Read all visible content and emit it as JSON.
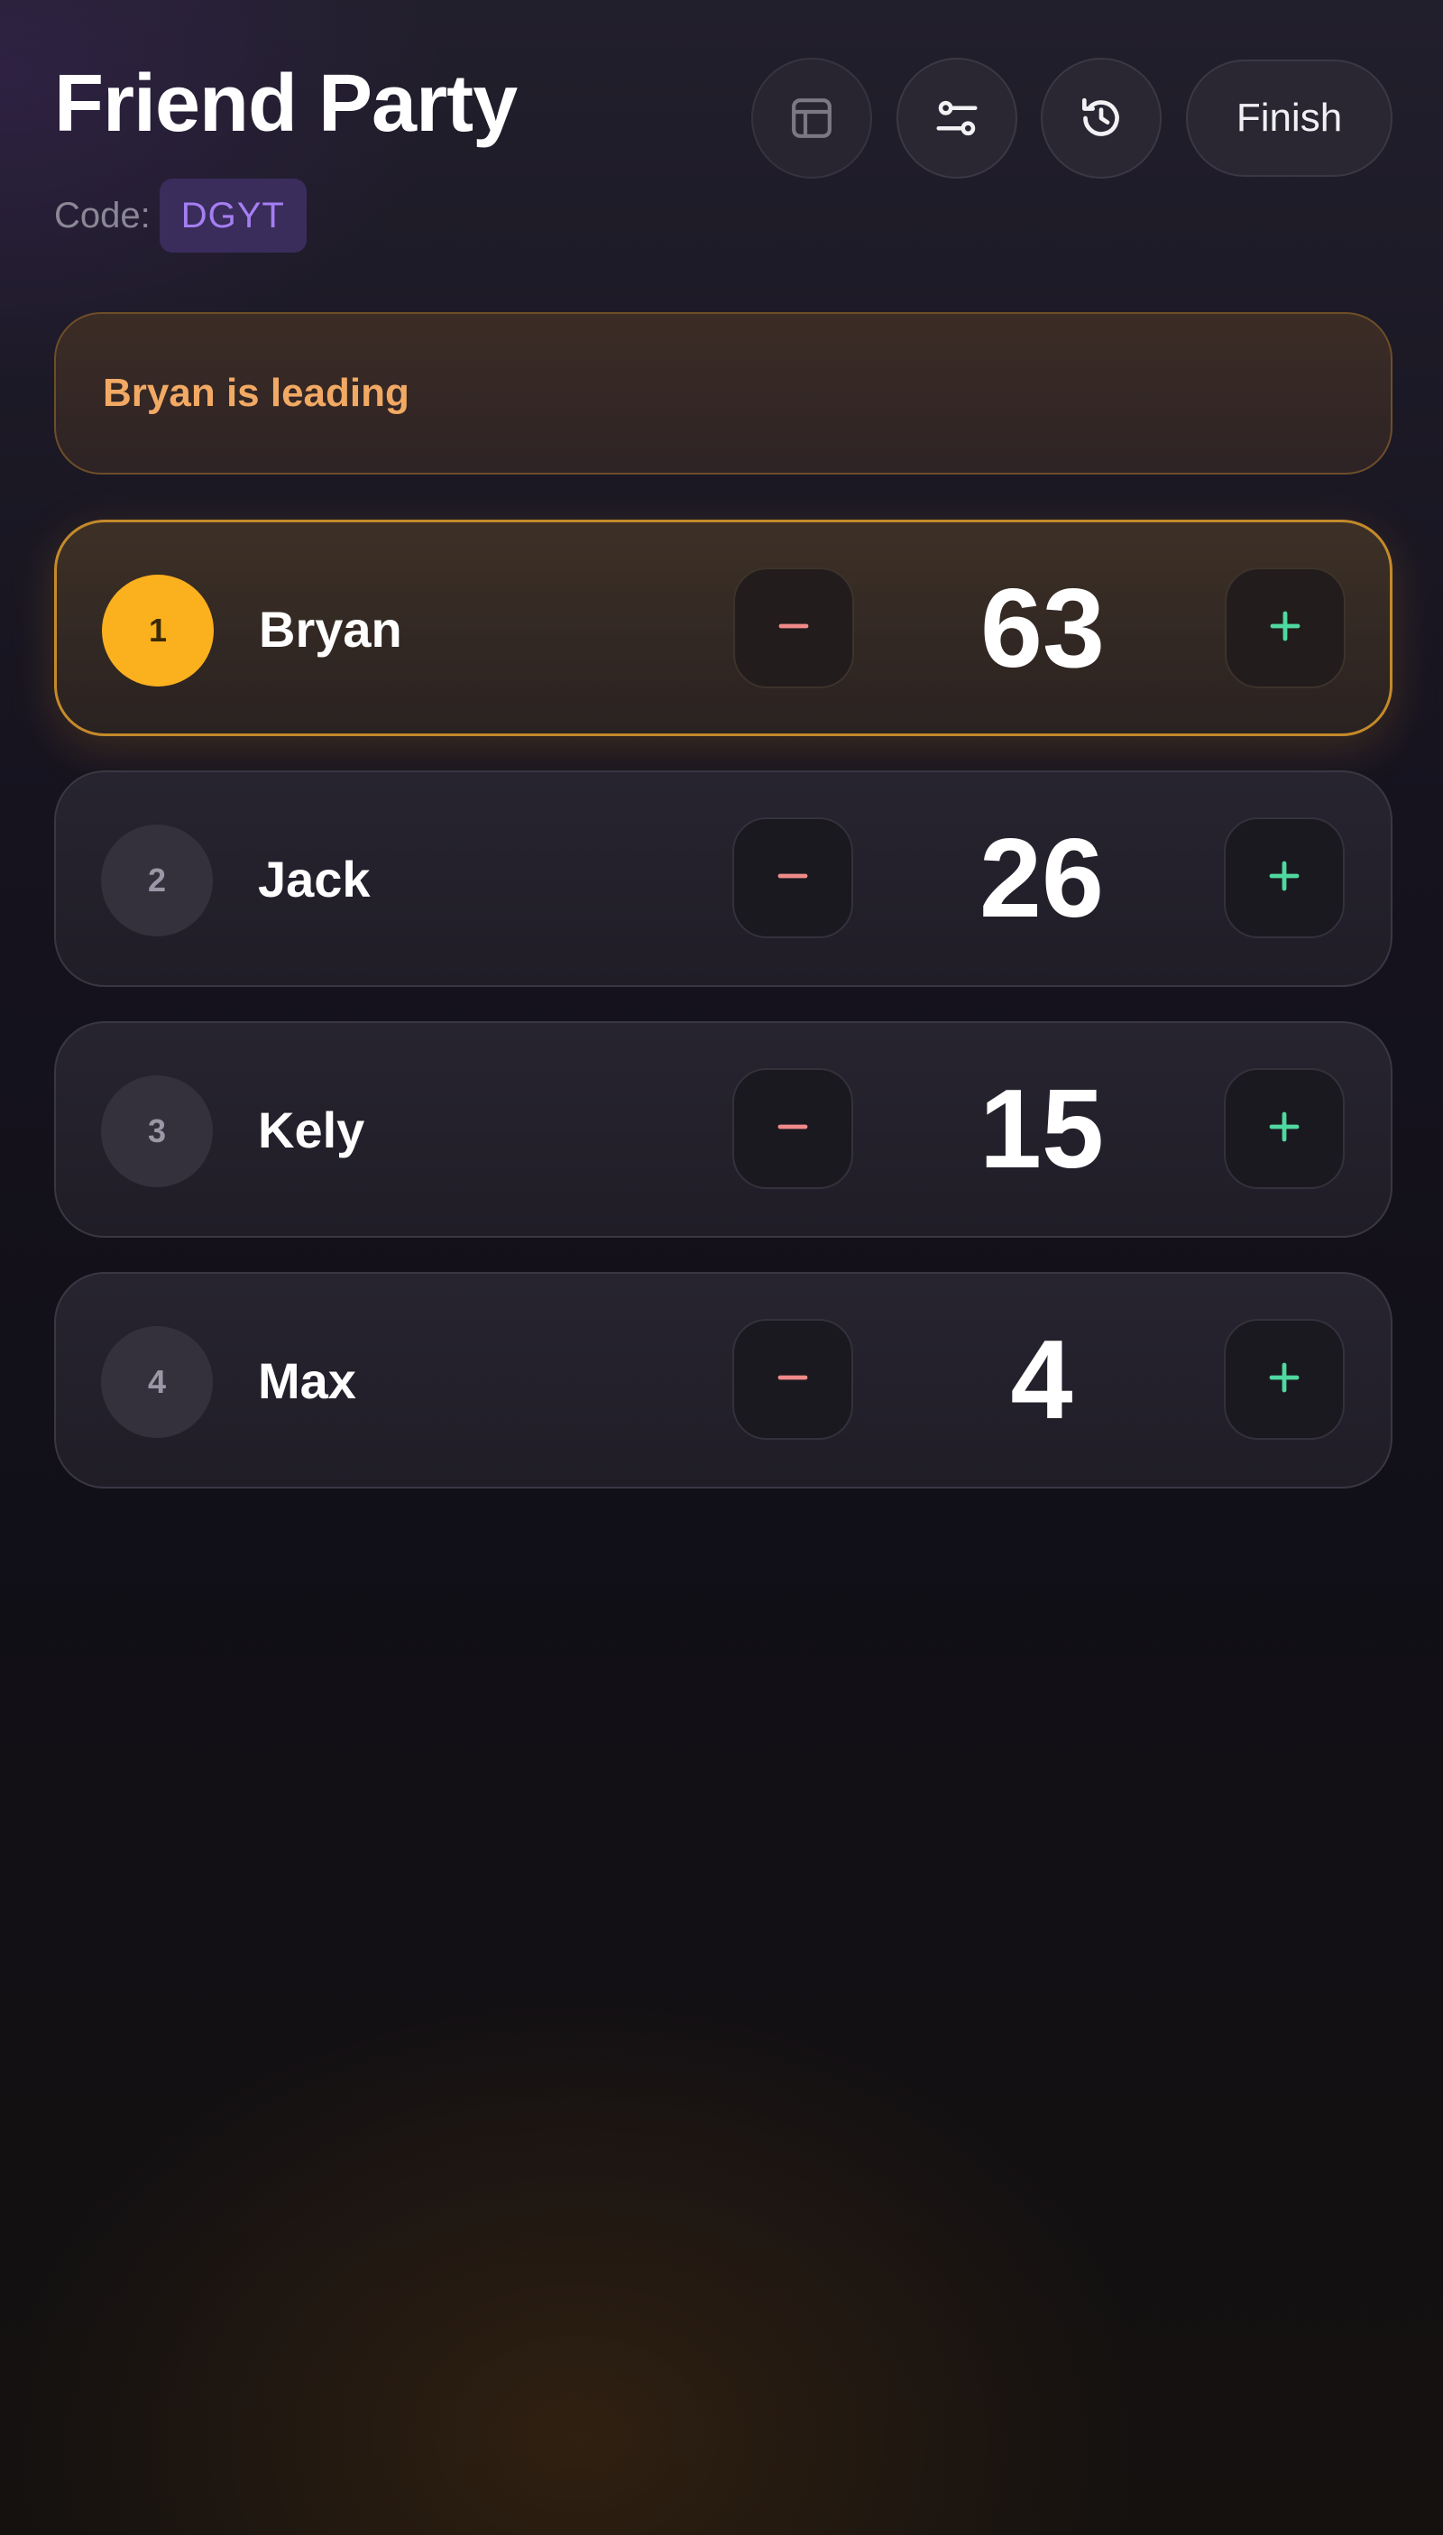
{
  "header": {
    "title": "Friend Party",
    "code_label": "Code:",
    "code_value": "DGYT",
    "buttons": {
      "table_icon": "table-icon",
      "settings_icon": "sliders-icon",
      "history_icon": "history-icon",
      "finish_label": "Finish"
    }
  },
  "banner": {
    "text": "Bryan is leading"
  },
  "players": [
    {
      "rank": "1",
      "name": "Bryan",
      "score": "63",
      "leader": true
    },
    {
      "rank": "2",
      "name": "Jack",
      "score": "26",
      "leader": false
    },
    {
      "rank": "3",
      "name": "Kely",
      "score": "15",
      "leader": false
    },
    {
      "rank": "4",
      "name": "Max",
      "score": "4",
      "leader": false
    }
  ],
  "colors": {
    "leader_accent": "#fbb01e",
    "banner_text": "#f2a964",
    "code_badge_text": "#a57ef2",
    "minus": "#f08a8a",
    "plus": "#4fd8a0"
  }
}
